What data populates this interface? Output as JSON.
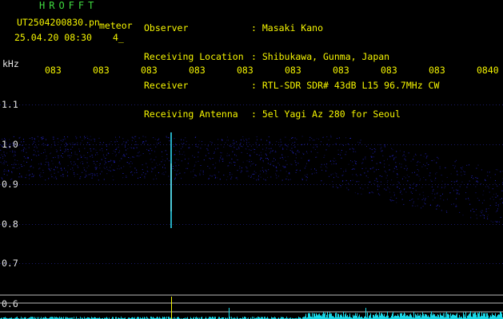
{
  "header": {
    "app_title": "HROFFT",
    "filename": "UT2504200830.pn",
    "meteor_label": "meteor",
    "datetime": "25.04.20 08:30",
    "count": "4_"
  },
  "meta": [
    {
      "label": "Observer",
      "value": ": Masaki Kano"
    },
    {
      "label": "Receiving Location",
      "value": ": Shibukawa, Gunma, Japan"
    },
    {
      "label": "Receiver",
      "value": ": RTL-SDR SDR# 43dB L15 96.7MHz CW"
    },
    {
      "label": "Receiving Antenna",
      "value": ": 5el Yagi Az 280 for Seoul"
    }
  ],
  "axis": {
    "y_unit": "kHz",
    "y_ticks": [
      "1.1",
      "1.0",
      "0.9",
      "0.8",
      "0.7",
      "0.6"
    ],
    "x_ticks": [
      "083",
      "083",
      "083",
      "083",
      "083",
      "083",
      "083",
      "083",
      "083",
      "0840"
    ]
  },
  "colors": {
    "background": "#000000",
    "signal": "#2e2eff",
    "meteor_trace": "#2ac9e0",
    "spectrum": "#19d7e6",
    "label_yellow": "#f5f500",
    "title_green": "#3fdc3f"
  }
}
